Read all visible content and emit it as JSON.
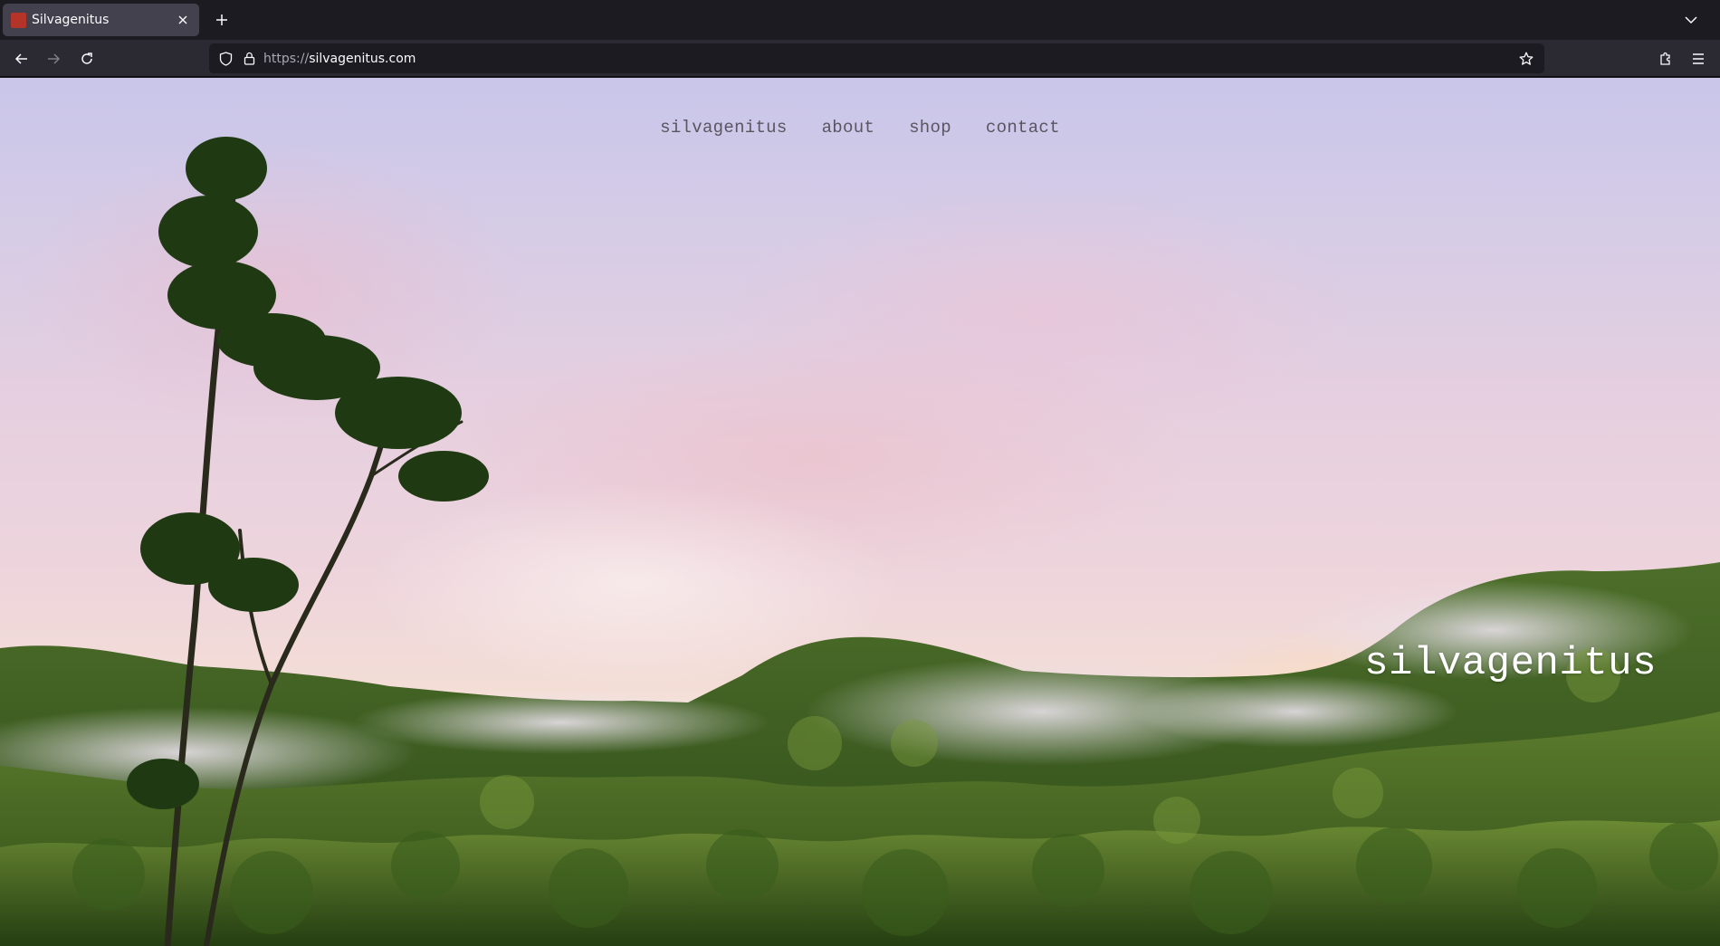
{
  "browser": {
    "tab": {
      "title": "Silvagenitus",
      "favicon_color": "#b5342a"
    },
    "url": {
      "scheme": "https://",
      "host": "silvagenitus.com"
    },
    "icons": {
      "close": "close-icon",
      "new_tab": "plus-icon",
      "tab_list": "chevron-down-icon",
      "back": "back-arrow-icon",
      "forward": "forward-arrow-icon",
      "reload": "reload-icon",
      "shield": "shield-icon",
      "lock": "lock-icon",
      "bookmark": "star-icon",
      "extensions": "puzzle-icon",
      "menu": "hamburger-icon"
    }
  },
  "site": {
    "nav": [
      {
        "label": "silvagenitus"
      },
      {
        "label": "about"
      },
      {
        "label": "shop"
      },
      {
        "label": "contact"
      }
    ],
    "brand": "silvagenitus"
  },
  "colors": {
    "chrome_dark": "#1c1b22",
    "chrome_bar": "#2b2a33",
    "tab_active": "#42414d",
    "nav_text": "#5a5560",
    "forest": "#3f6b22"
  }
}
